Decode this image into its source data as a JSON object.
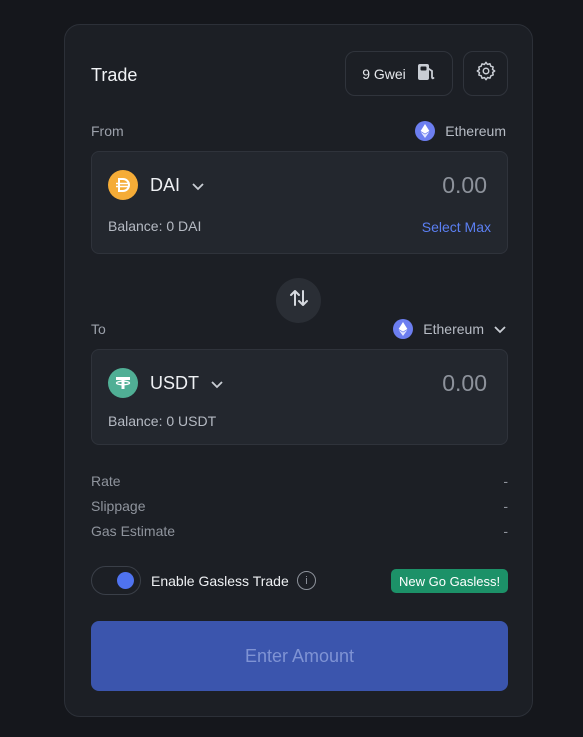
{
  "header": {
    "title": "Trade",
    "gas_label": "9 Gwei"
  },
  "from": {
    "label": "From",
    "network": "Ethereum",
    "token": "DAI",
    "amount": "0.00",
    "balance": "Balance: 0 DAI",
    "select_max": "Select Max"
  },
  "to": {
    "label": "To",
    "network": "Ethereum",
    "token": "USDT",
    "amount": "0.00",
    "balance": "Balance: 0 USDT"
  },
  "details": [
    {
      "label": "Rate",
      "value": "-"
    },
    {
      "label": "Slippage",
      "value": "-"
    },
    {
      "label": "Gas Estimate",
      "value": "-"
    }
  ],
  "gasless": {
    "label": "Enable Gasless Trade",
    "info": "i",
    "enabled": true,
    "badge": "New Go Gasless!"
  },
  "cta": {
    "label": "Enter Amount"
  },
  "colors": {
    "accent": "#4f73f0",
    "dai": "#f5ac37",
    "usdt": "#50af95",
    "ethereum": "#6c7ef0",
    "badge": "#1c9168",
    "button": "#3b55ad"
  },
  "icons": [
    "gas-pump-icon",
    "gear-icon",
    "ethereum-icon",
    "dai-icon",
    "usdt-icon",
    "chevron-down-icon",
    "swap-arrows-icon",
    "info-icon"
  ]
}
